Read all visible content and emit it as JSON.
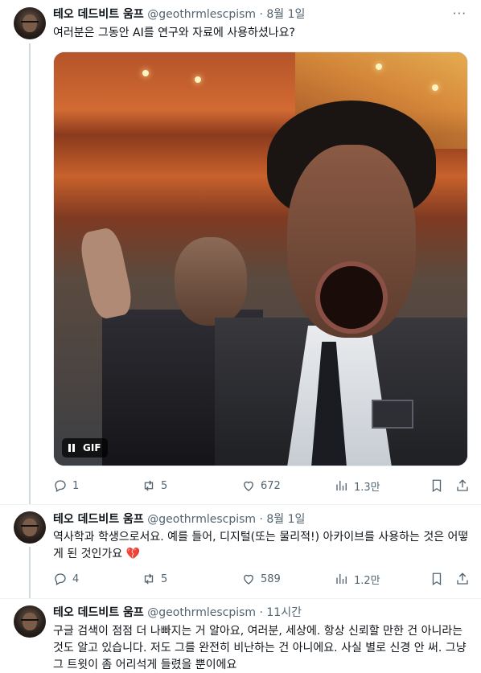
{
  "tweets": [
    {
      "author_name": "테오 데드비트 움프",
      "handle": "@geothrmlescpism",
      "sep": "·",
      "time": "8월 1일",
      "text": "여러분은 그동안 AI를 연구와 자료에 사용하셨나요?",
      "media": {
        "type": "gif",
        "badge": "GIF"
      },
      "stats": {
        "replies": "1",
        "retweets": "5",
        "likes": "672",
        "views": "1.3만"
      }
    },
    {
      "author_name": "테오 데드비트 움프",
      "handle": "@geothrmlescpism",
      "sep": "·",
      "time": "8월 1일",
      "text": "역사학과 학생으로서요. 예를 들어, 디지털(또는 물리적!) 아카이브를 사용하는 것은 어떻게 된 것인가요 💔",
      "stats": {
        "replies": "4",
        "retweets": "5",
        "likes": "589",
        "views": "1.2만"
      }
    },
    {
      "author_name": "테오 데드비트 움프",
      "handle": "@geothrmlescpism",
      "sep": "·",
      "time": "11시간",
      "text": "구글 검색이 점점 더 나빠지는 거 알아요, 여러분, 세상에. 항상 신뢰할 만한 건 아니라는 것도 알고 있습니다. 저도 그를 완전히 비난하는 건 아니에요. 사실 별로 신경 안 써. 그냥 그 트윗이 좀 어리석게 들렸을 뿐이에요"
    }
  ],
  "icons": [
    "more-icon",
    "pause-icon",
    "reply-icon",
    "retweet-icon",
    "like-icon",
    "views-icon",
    "bookmark-icon",
    "share-icon"
  ],
  "colors": {
    "text": "#0f1419",
    "secondary": "#536471",
    "divider": "#eff3f4",
    "thread_line": "#cfd9de"
  }
}
